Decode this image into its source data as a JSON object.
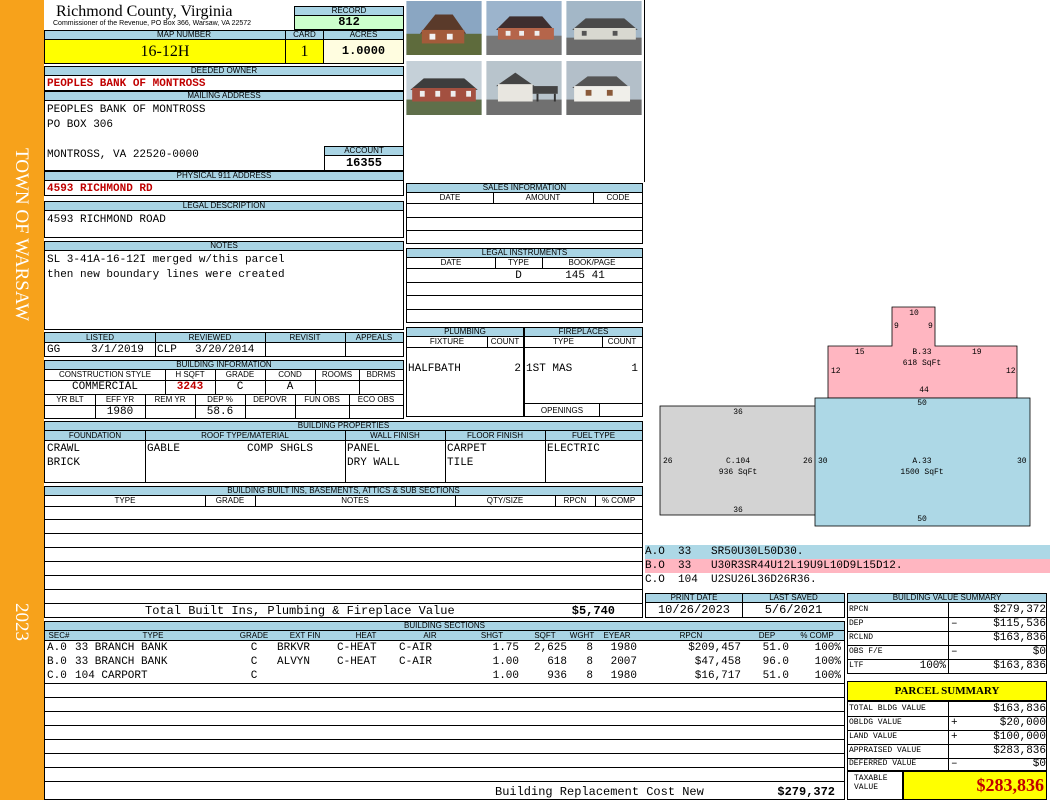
{
  "sidebar": {
    "town": "TOWN OF WARSAW",
    "year": "2023"
  },
  "header": {
    "county": "Richmond County, Virginia",
    "commissioner": "Commissioner of the Revenue, PO Box 366, Warsaw, VA 22572",
    "record_label": "RECORD",
    "record": "812",
    "map_number_label": "MAP NUMBER",
    "map_number": "16-12H",
    "card_label": "CARD",
    "card": "1",
    "acres_label": "ACRES",
    "acres": "1.0000"
  },
  "owner": {
    "deeded_owner_label": "DEEDED OWNER",
    "deeded_owner": "PEOPLES BANK OF MONTROSS",
    "mailing_label": "MAILING ADDRESS",
    "mailing": [
      "PEOPLES BANK OF MONTROSS",
      "PO BOX 306",
      "",
      "MONTROSS, VA 22520-0000"
    ],
    "account_label": "ACCOUNT",
    "account": "16355",
    "physical_label": "PHYSICAL 911 ADDRESS",
    "physical": "4593 RICHMOND RD",
    "legal_label": "LEGAL DESCRIPTION",
    "legal": "4593 RICHMOND ROAD",
    "notes_label": "NOTES",
    "notes": [
      "SL 3-41A-16-12I merged w/this parcel",
      "then new boundary lines were created"
    ]
  },
  "sales": {
    "title": "SALES INFORMATION",
    "headers": [
      "DATE",
      "AMOUNT",
      "CODE"
    ]
  },
  "legal_instruments": {
    "title": "LEGAL INSTRUMENTS",
    "headers": [
      "DATE",
      "TYPE",
      "BOOK/PAGE"
    ],
    "rows": [
      {
        "date": "",
        "type": "D",
        "book": "145 41"
      }
    ]
  },
  "listed": {
    "headers": [
      "LISTED",
      "REVIEWED",
      "REVISIT",
      "APPEALS"
    ],
    "listed_by": "GG",
    "listed_date": "3/1/2019",
    "reviewed_by": "CLP",
    "reviewed_date": "3/20/2014"
  },
  "building_info": {
    "title": "BUILDING INFORMATION",
    "headers": [
      "CONSTRUCTION STYLE",
      "H SQFT",
      "GRADE",
      "COND",
      "ROOMS",
      "BDRMS"
    ],
    "style": "COMMERCIAL",
    "hsqft": "3243",
    "grade": "C",
    "cond": "A",
    "headers2": [
      "YR BLT",
      "EFF YR",
      "REM YR",
      "DEP %",
      "DEPOVR",
      "FUN OBS",
      "ECO OBS"
    ],
    "eff_yr": "1980",
    "dep": "58.6"
  },
  "plumbing": {
    "title": "PLUMBING",
    "headers": [
      "FIXTURE",
      "COUNT"
    ],
    "fixture": "HALFBATH",
    "count": "2"
  },
  "fireplaces": {
    "title": "FIREPLACES",
    "headers": [
      "TYPE",
      "COUNT"
    ],
    "type": "1ST MAS",
    "count": "1",
    "openings_label": "OPENINGS"
  },
  "building_properties": {
    "title": "BUILDING PROPERTIES",
    "headers": [
      "FOUNDATION",
      "ROOF TYPE/MATERIAL",
      "WALL FINISH",
      "FLOOR FINISH",
      "FUEL TYPE"
    ],
    "foundation": [
      "CRAWL",
      "BRICK"
    ],
    "roof_type": "GABLE",
    "roof_material": "COMP SHGLS",
    "wall": [
      "PANEL",
      "DRY WALL"
    ],
    "floor": [
      "CARPET",
      "TILE"
    ],
    "fuel": "ELECTRIC"
  },
  "built_ins": {
    "title": "BUILDING BUILT INS, BASEMENTS, ATTICS & SUB SECTIONS",
    "headers": [
      "TYPE",
      "GRADE",
      "NOTES",
      "QTY/SIZE",
      "RPCN",
      "% COMP"
    ],
    "total_label": "Total Built Ins, Plumbing & Fireplace Value",
    "total": "$5,740"
  },
  "sketch": {
    "b": {
      "label": "B.33",
      "area": "618 SqFt",
      "dims": [
        "10",
        "9",
        "9",
        "15",
        "19",
        "12",
        "12",
        "44"
      ]
    },
    "a": {
      "label": "A.33",
      "area": "1500 SqFt",
      "dims": [
        "50",
        "30",
        "30",
        "50"
      ]
    },
    "c": {
      "label": "C.104",
      "area": "936 SqFt",
      "dims": [
        "36",
        "26",
        "26",
        "36"
      ]
    },
    "legend": [
      {
        "text": "A.O  33   SR50U30L50D30.",
        "color": "#add8e6"
      },
      {
        "text": "B.O  33   U30R3SR44U12L19U9L10D9L15D12.",
        "color": "#ffb6c1"
      },
      {
        "text": "C.O  104  U2SU26L36D26R36.",
        "color": "#ffffff"
      }
    ]
  },
  "print": {
    "print_label": "PRINT DATE",
    "print_date": "10/26/2023",
    "saved_label": "LAST SAVED",
    "saved_date": "5/6/2021"
  },
  "value_summary": {
    "title": "BUILDING VALUE SUMMARY",
    "rows": [
      {
        "label": "RPCN",
        "sign": "",
        "value": "$279,372"
      },
      {
        "label": "DEP",
        "sign": "–",
        "value": "$115,536"
      },
      {
        "label": "RCLND",
        "sign": "",
        "value": "$163,836"
      },
      {
        "label": "OBS F/E",
        "sign": "–",
        "value": "$0"
      },
      {
        "label": "LTF",
        "pct": "100%",
        "sign": "",
        "value": "$163,836"
      }
    ]
  },
  "parcel_summary": {
    "title": "PARCEL SUMMARY",
    "rows": [
      {
        "label": "TOTAL BLDG VALUE",
        "sign": "",
        "value": "$163,836"
      },
      {
        "label": "OBLDG VALUE",
        "sign": "+",
        "value": "$20,000"
      },
      {
        "label": "LAND VALUE",
        "sign": "+",
        "value": "$100,000"
      },
      {
        "label": "APPRAISED VALUE",
        "sign": "",
        "value": "$283,836"
      },
      {
        "label": "DEFERRED VALUE",
        "sign": "–",
        "value": "$0"
      }
    ],
    "taxable_label": "TAXABLE VALUE",
    "taxable": "$283,836"
  },
  "building_sections": {
    "title": "BUILDING SECTIONS",
    "headers": [
      "SEC#",
      "TYPE",
      "GRADE",
      "EXT FIN",
      "HEAT",
      "AIR",
      "SHGT",
      "SQFT",
      "WGHT",
      "EYEAR",
      "RPCN",
      "DEP",
      "% COMP"
    ],
    "rows": [
      [
        "A.0",
        "33 BRANCH BANK",
        "C",
        "BRKVR",
        "C-HEAT",
        "C-AIR",
        "1.75",
        "2,625",
        "8",
        "1980",
        "$209,457",
        "51.0",
        "100%"
      ],
      [
        "B.0",
        "33 BRANCH BANK",
        "C",
        "ALVYN",
        "C-HEAT",
        "C-AIR",
        "1.00",
        "618",
        "8",
        "2007",
        "$47,458",
        "96.0",
        "100%"
      ],
      [
        "C.0",
        "104 CARPORT",
        "C",
        "",
        "",
        "",
        "1.00",
        "936",
        "8",
        "1980",
        "$16,717",
        "51.0",
        "100%"
      ]
    ],
    "replacement_label": "Building Replacement Cost New",
    "replacement": "$279,372"
  },
  "colors": {
    "sidebar": "#f7a21b",
    "header_bar": "#a9d4e4",
    "yellow": "#ffff00",
    "record_green": "#ccffcc",
    "red_text": "#c00000"
  }
}
